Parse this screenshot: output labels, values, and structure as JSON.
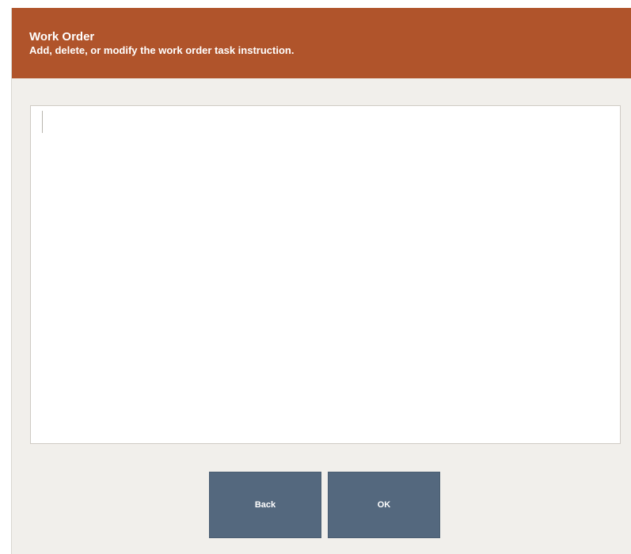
{
  "header": {
    "title": "Work Order",
    "subtitle": "Add, delete, or modify the work order task instruction."
  },
  "task_instruction": {
    "value": "",
    "placeholder": ""
  },
  "buttons": {
    "back_label": "Back",
    "ok_label": "OK"
  },
  "colors": {
    "header_bg": "#b0542b",
    "panel_bg": "#f1efeb",
    "button_bg": "#54687e"
  }
}
